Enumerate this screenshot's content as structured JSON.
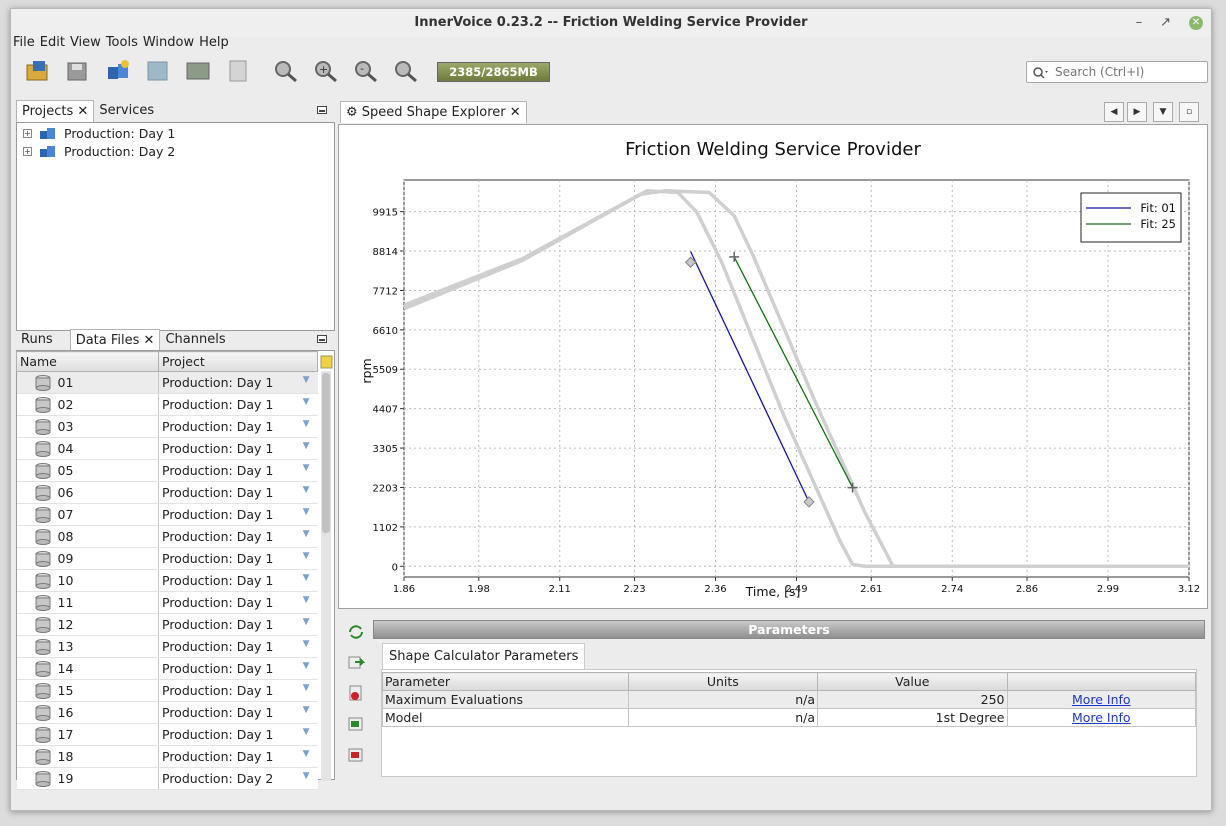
{
  "window": {
    "title": "InnerVoice 0.23.2 -- Friction Welding Service Provider"
  },
  "menu": [
    "File",
    "Edit",
    "View",
    "Tools",
    "Window",
    "Help"
  ],
  "toolbar": {
    "memory": "2385/2865MB",
    "search_placeholder": "Search (Ctrl+I)"
  },
  "projects_panel": {
    "tabs": [
      "Projects",
      "Services"
    ],
    "items": [
      "Production: Day 1",
      "Production: Day 2"
    ]
  },
  "files_panel": {
    "tabs": [
      "Runs",
      "Data Files",
      "Channels"
    ],
    "columns": [
      "Name",
      "Project"
    ],
    "rows": [
      {
        "name": "01",
        "project": "Production: Day 1"
      },
      {
        "name": "02",
        "project": "Production: Day 1"
      },
      {
        "name": "03",
        "project": "Production: Day 1"
      },
      {
        "name": "04",
        "project": "Production: Day 1"
      },
      {
        "name": "05",
        "project": "Production: Day 1"
      },
      {
        "name": "06",
        "project": "Production: Day 1"
      },
      {
        "name": "07",
        "project": "Production: Day 1"
      },
      {
        "name": "08",
        "project": "Production: Day 1"
      },
      {
        "name": "09",
        "project": "Production: Day 1"
      },
      {
        "name": "10",
        "project": "Production: Day 1"
      },
      {
        "name": "11",
        "project": "Production: Day 1"
      },
      {
        "name": "12",
        "project": "Production: Day 1"
      },
      {
        "name": "13",
        "project": "Production: Day 1"
      },
      {
        "name": "14",
        "project": "Production: Day 1"
      },
      {
        "name": "15",
        "project": "Production: Day 1"
      },
      {
        "name": "16",
        "project": "Production: Day 1"
      },
      {
        "name": "17",
        "project": "Production: Day 1"
      },
      {
        "name": "18",
        "project": "Production: Day 1"
      },
      {
        "name": "19",
        "project": "Production: Day 2"
      }
    ]
  },
  "editor": {
    "tab": "Speed Shape Explorer"
  },
  "chart_data": {
    "type": "line",
    "title": "Friction Welding Service Provider",
    "xlabel": "Time, [s]",
    "ylabel": "rpm",
    "xlim": [
      1.86,
      3.12
    ],
    "ylim": [
      -300,
      10800
    ],
    "xticks": [
      "1.86",
      "1.98",
      "2.11",
      "2.23",
      "2.36",
      "2.49",
      "2.61",
      "2.74",
      "2.86",
      "2.99",
      "3.12"
    ],
    "yticks": [
      "0",
      "1102",
      "2203",
      "3305",
      "4407",
      "5509",
      "6610",
      "7712",
      "8814",
      "9915"
    ],
    "grid": true,
    "legend_position": "top-right",
    "background_curves": [
      [
        [
          1.86,
          7300
        ],
        [
          2.05,
          8600
        ],
        [
          2.25,
          10500
        ],
        [
          2.3,
          10450
        ],
        [
          2.33,
          9900
        ],
        [
          2.37,
          8500
        ],
        [
          2.47,
          4200
        ],
        [
          2.56,
          700
        ],
        [
          2.58,
          50
        ],
        [
          2.6,
          0
        ],
        [
          3.12,
          0
        ]
      ],
      [
        [
          1.86,
          7200
        ],
        [
          2.05,
          8550
        ],
        [
          2.24,
          10400
        ],
        [
          2.28,
          10500
        ],
        [
          2.35,
          10450
        ],
        [
          2.39,
          9800
        ],
        [
          2.42,
          8700
        ],
        [
          2.52,
          4600
        ],
        [
          2.6,
          1500
        ],
        [
          2.645,
          0
        ],
        [
          3.12,
          0
        ]
      ]
    ],
    "series": [
      {
        "name": "Fit: 01",
        "color": "#1414a8",
        "points": [
          [
            2.32,
            8800
          ],
          [
            2.51,
            1800
          ]
        ]
      },
      {
        "name": "Fit: 25",
        "color": "#167016",
        "points": [
          [
            2.39,
            8650
          ],
          [
            2.58,
            2200
          ]
        ]
      }
    ],
    "markers": [
      {
        "series": "Fit: 01",
        "shape": "diamond",
        "points": [
          [
            2.32,
            8500
          ],
          [
            2.51,
            1800
          ]
        ]
      },
      {
        "series": "Fit: 25",
        "shape": "cross",
        "points": [
          [
            2.39,
            8650
          ],
          [
            2.58,
            2200
          ]
        ]
      }
    ]
  },
  "parameters": {
    "header": "Parameters",
    "tab": "Shape Calculator Parameters",
    "columns": [
      "Parameter",
      "Units",
      "Value",
      ""
    ],
    "rows": [
      {
        "parameter": "Maximum Evaluations",
        "units": "n/a",
        "value": "250",
        "link": "More Info"
      },
      {
        "parameter": "Model",
        "units": "n/a",
        "value": "1st Degree",
        "link": "More Info"
      }
    ]
  }
}
